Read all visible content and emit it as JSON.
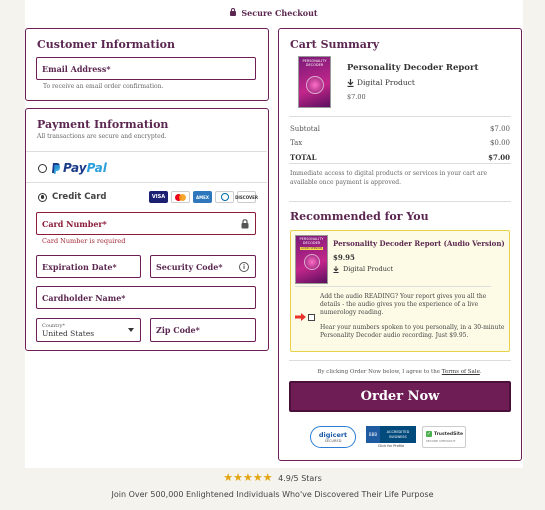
{
  "header": {
    "secure_label": "Secure Checkout"
  },
  "customer": {
    "title": "Customer Information",
    "email_placeholder": "Email Address*",
    "email_help": "To receive an email order confirmation."
  },
  "payment": {
    "title": "Payment Information",
    "subtitle": "All transactions are secure and encrypted.",
    "paypal_a": "Pay",
    "paypal_b": "Pal",
    "credit_card_label": "Credit Card",
    "card_logos": [
      "VISA",
      "MC",
      "AMEX",
      "DINERS",
      "DISCOVER"
    ],
    "card_number_placeholder": "Card Number*",
    "card_number_error": "Card Number is required",
    "expiration_placeholder": "Expiration Date*",
    "security_placeholder": "Security Code*",
    "info_glyph": "i",
    "cardholder_placeholder": "Cardholder Name*",
    "country_label": "Country*",
    "country_value": "United States",
    "zip_placeholder": "Zip Code*"
  },
  "cart": {
    "title": "Cart Summary",
    "product_name": "Personality Decoder Report",
    "product_type": "Digital Product",
    "product_price": "$7.00",
    "cover_text": "PERSONALITY DECODER",
    "subtotal_label": "Subtotal",
    "subtotal_value": "$7.00",
    "tax_label": "Tax",
    "tax_value": "$0.00",
    "total_label": "TOTAL",
    "total_value": "$7.00",
    "note": "Immediate access to digital products or services in your cart are available once payment is approved."
  },
  "recommend": {
    "title": "Recommended for You",
    "name": "Personality Decoder Report (Audio Version)",
    "price": "$9.95",
    "type": "Digital Product",
    "cover_text": "PERSONALITY DECODER",
    "cover_sub": "AUDIO VERSION",
    "desc1": "Add the audio READING? Your report gives you all the details - the audio gives you the experience of a live numerology reading.",
    "desc2": "Hear your numbers spoken to you personally, in a 30-minute Personality Decoder audio recording. Just $9.95."
  },
  "terms": {
    "prefix": "By clicking Order Now below, I agree to the",
    "link": "Terms of Sale",
    "suffix": "."
  },
  "order_button": "Order Now",
  "badges": {
    "digicert": "digicert",
    "digicert_sub": "SECURED",
    "bbb": "BBB",
    "bbb_line1": "ACCREDITED",
    "bbb_line2": "BUSINESS",
    "bbb_sub": "Click for Profile",
    "trusted": "TrustedSite",
    "trusted_sub": "SECURE CHECKOUT"
  },
  "footer": {
    "rating": "4.9/5 Stars",
    "tagline": "Join Over 500,000 Enlightened Individuals Who've Discovered Their Life Purpose"
  },
  "colors": {
    "brand": "#6e1e55",
    "highlight_bg": "#fdfbe6",
    "highlight_border": "#e8d24a"
  }
}
